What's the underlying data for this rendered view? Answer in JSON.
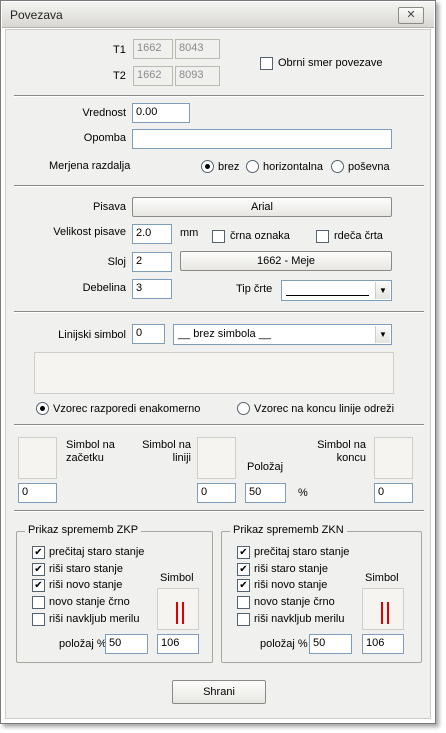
{
  "window": {
    "title": "Povezava",
    "close_glyph": "✕"
  },
  "header": {
    "t1_label": "T1",
    "t1_a": "1662",
    "t1_b": "8043",
    "t2_label": "T2",
    "t2_a": "1662",
    "t2_b": "8093",
    "reverse_label": "Obrni smer povezave"
  },
  "value": {
    "vrednost_label": "Vrednost",
    "vrednost_value": "0.00",
    "opomba_label": "Opomba",
    "opomba_value": "",
    "razdalja_label": "Merjena razdalja",
    "options": [
      "brez",
      "horizontalna",
      "poševna"
    ],
    "selected": "brez"
  },
  "font": {
    "pisava_label": "Pisava",
    "pisava_value": "Arial",
    "velikost_label": "Velikost pisave",
    "velikost_value": "2.0",
    "unit": "mm",
    "crna_label": "črna oznaka",
    "rdeca_label": "rdeča črta",
    "sloj_label": "Sloj",
    "sloj_value": "2",
    "sloj_button": "1662 - Meje",
    "debelina_label": "Debelina",
    "debelina_value": "3",
    "tip_label": "Tip črte"
  },
  "linesym": {
    "label": "Linijski simbol",
    "number": "0",
    "combo_value": "__ brez simbola __",
    "radio_even": "Vzorec razporedi enakomerno",
    "radio_end": "Vzorec na koncu linije odreži",
    "selected": "even"
  },
  "symbols": {
    "start_label": "Simbol na začetku",
    "start_value": "0",
    "line_label": "Simbol na liniji",
    "line_value": "0",
    "pos_label": "Položaj",
    "pos_value": "50",
    "pos_unit": "%",
    "end_label": "Simbol na koncu",
    "end_value": "0"
  },
  "zkp": {
    "title": "Prikaz sprememb ZKP",
    "items": [
      {
        "label": "prečitaj staro stanje",
        "checked": true
      },
      {
        "label": "riši staro stanje",
        "checked": true
      },
      {
        "label": "riši novo stanje",
        "checked": true
      },
      {
        "label": "novo stanje črno",
        "checked": false
      },
      {
        "label": "riši navkljub merilu",
        "checked": false
      }
    ],
    "symbol_label": "Simbol",
    "pos_label": "položaj %",
    "pos_value": "50",
    "sym_value": "106"
  },
  "zkn": {
    "title": "Prikaz sprememb ZKN",
    "items": [
      {
        "label": "prečitaj staro stanje",
        "checked": true
      },
      {
        "label": "riši staro stanje",
        "checked": true
      },
      {
        "label": "riši novo stanje",
        "checked": true
      },
      {
        "label": "novo stanje črno",
        "checked": false
      },
      {
        "label": "riši navkljub merilu",
        "checked": false
      }
    ],
    "symbol_label": "Simbol",
    "pos_label": "položaj %",
    "pos_value": "50",
    "sym_value": "106"
  },
  "footer": {
    "save_label": "Shrani"
  },
  "colors": {
    "symbol_red": "#e00000"
  },
  "check_glyph": "✔"
}
